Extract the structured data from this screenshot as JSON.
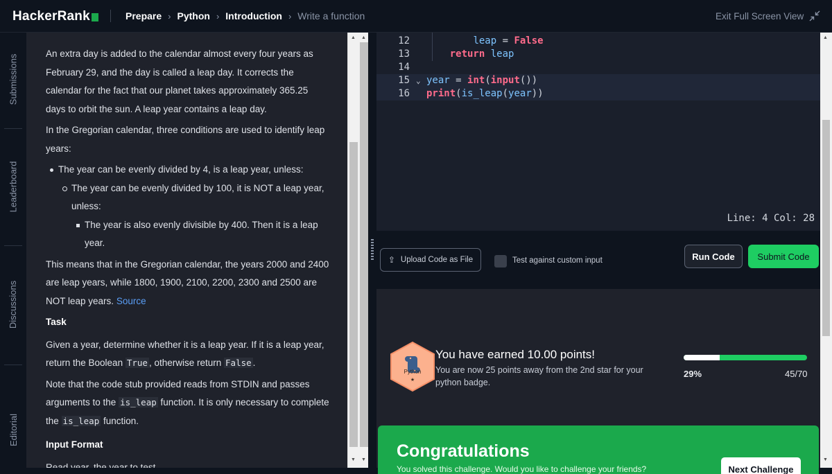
{
  "brand": {
    "name": "HackerRank",
    "accent": "#1ba94c"
  },
  "breadcrumbs": [
    {
      "label": "Prepare"
    },
    {
      "label": "Python"
    },
    {
      "label": "Introduction"
    },
    {
      "label": "Write a function"
    }
  ],
  "header": {
    "exit_fullscreen": "Exit Full Screen View",
    "exit_icon": "shrink-icon"
  },
  "side_tabs": [
    "Submissions",
    "Leaderboard",
    "Discussions",
    "Editorial"
  ],
  "problem": {
    "intro": "An extra day is added to the calendar almost every four years as February 29, and the day is called a leap day. It corrects the calendar for the fact that our planet takes approximately 365.25 days to orbit the sun. A leap year contains a leap day.",
    "conditions_intro": "In the Gregorian calendar, three conditions are used to identify leap years:",
    "bullet1": "The year can be evenly divided by 4, is a leap year, unless:",
    "bullet2": "The year can be evenly divided by 100, it is NOT a leap year, unless:",
    "bullet3": "The year is also evenly divisible by 400. Then it is a leap year.",
    "summary": "This means that in the Gregorian calendar, the years 2000 and 2400 are leap years, while 1800, 1900, 2100, 2200, 2300 and 2500 are NOT leap years.",
    "source_link": "Source",
    "task_heading": "Task",
    "task_pre": "Given a year, determine whether it is a leap year. If it is a leap year, return the Boolean",
    "task_true": "True",
    "task_mid": ", otherwise return",
    "task_false": "False",
    "task_end": ".",
    "note_pre": "Note that the code stub provided reads from STDIN and passes arguments to the",
    "note_fn": "is_leap",
    "note_mid": "function. It is only necessary to complete the",
    "note_fn2": "is_leap",
    "note_end": "function.",
    "input_heading": "Input Format",
    "input_text": "Read year, the year to test."
  },
  "editor": {
    "lines": [
      {
        "num": "12",
        "indent": "        ",
        "parts": [
          [
            "id",
            "leap"
          ],
          [
            "op",
            " = "
          ],
          [
            "kw",
            "False"
          ]
        ]
      },
      {
        "num": "13",
        "indent": "    ",
        "parts": [
          [
            "kw",
            "return"
          ],
          [
            "op",
            " "
          ],
          [
            "id",
            "leap"
          ]
        ]
      },
      {
        "num": "14",
        "indent": "",
        "parts": []
      },
      {
        "num": "15",
        "indent": "",
        "fold": true,
        "parts": [
          [
            "id",
            "year"
          ],
          [
            "op",
            " = "
          ],
          [
            "kw",
            "int"
          ],
          [
            "op",
            "("
          ],
          [
            "kw",
            "input"
          ],
          [
            "op",
            "())"
          ]
        ]
      },
      {
        "num": "16",
        "indent": "",
        "parts": [
          [
            "kw",
            "print"
          ],
          [
            "op",
            "("
          ],
          [
            "id",
            "is_leap"
          ],
          [
            "op",
            "("
          ],
          [
            "id",
            "year"
          ],
          [
            "op",
            "))"
          ]
        ]
      }
    ],
    "cursor_status": "Line: 4 Col: 28"
  },
  "actions": {
    "upload_label": "Upload Code as File",
    "upload_icon": "upload-icon",
    "custom_input_label": "Test against custom input",
    "custom_input_checked": false,
    "run_label": "Run Code",
    "submit_label": "Submit Code"
  },
  "result": {
    "badge_name": "Python",
    "badge_stars": "★",
    "earned": "You have earned 10.00 points!",
    "earned_sub": "You are now 25 points away from the 2nd star for your python badge.",
    "progress_fraction": 0.29,
    "progress_pct": "29%",
    "progress_ratio": "45/70",
    "congrats_title": "Congratulations",
    "congrats_sub": "You solved this challenge. Would you like to challenge your friends?",
    "next_label": "Next Challenge"
  }
}
